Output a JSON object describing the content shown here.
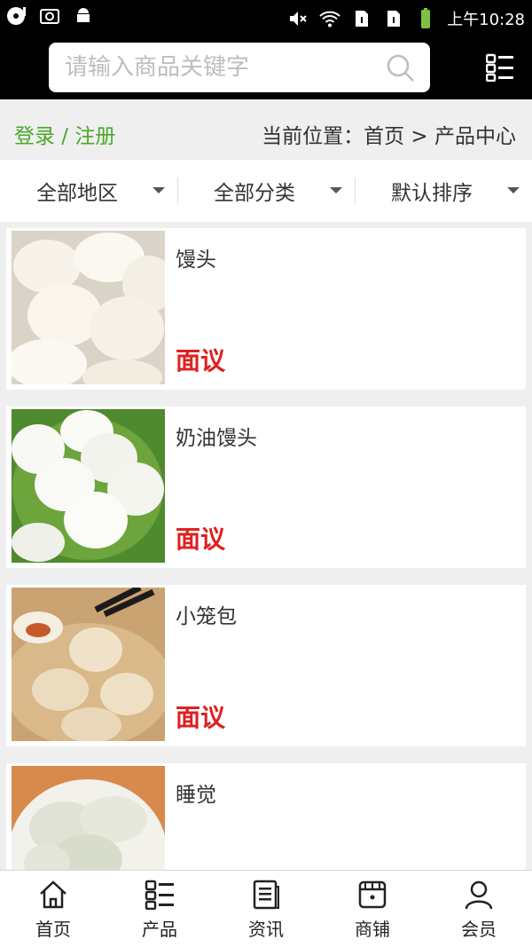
{
  "status_bar": {
    "time": "上午10:28",
    "icons": [
      "cd-icon",
      "screenshot-icon",
      "android-icon",
      "mute-icon",
      "wifi-icon",
      "sim1-icon",
      "sim2-icon",
      "battery-icon"
    ]
  },
  "header": {
    "search_placeholder": "请输入商品关键字",
    "search_icon": "search-icon",
    "menu_icon": "menu-icon"
  },
  "breadcrumb": {
    "login_register": "登录 / 注册",
    "location": "当前位置：首页 > 产品中心"
  },
  "filters": [
    {
      "label": "全部地区"
    },
    {
      "label": "全部分类"
    },
    {
      "label": "默认排序"
    }
  ],
  "products": [
    {
      "name": "馒头",
      "price": "面议"
    },
    {
      "name": "奶油馒头",
      "price": "面议"
    },
    {
      "name": "小笼包",
      "price": "面议"
    },
    {
      "name": "睡觉",
      "price": ""
    }
  ],
  "bottom_nav": [
    {
      "label": "首页",
      "icon": "home-icon"
    },
    {
      "label": "产品",
      "icon": "grid-list-icon"
    },
    {
      "label": "资讯",
      "icon": "news-icon"
    },
    {
      "label": "商铺",
      "icon": "shop-icon"
    },
    {
      "label": "会员",
      "icon": "user-icon"
    }
  ],
  "colors": {
    "green": "#4aa829",
    "price_red": "#e02020",
    "header_bg": "#000000"
  }
}
